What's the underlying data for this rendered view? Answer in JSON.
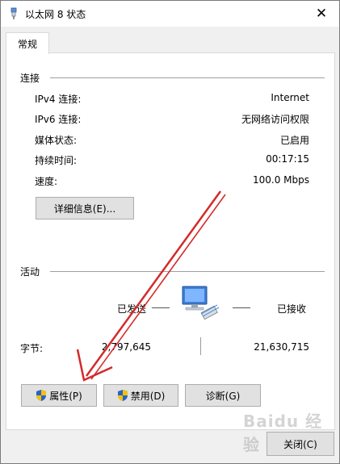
{
  "window": {
    "title": "以太网 8 状态",
    "tab": "常规"
  },
  "connection": {
    "heading": "连接",
    "rows": [
      {
        "label": "IPv4 连接:",
        "value": "Internet"
      },
      {
        "label": "IPv6 连接:",
        "value": "无网络访问权限"
      },
      {
        "label": "媒体状态:",
        "value": "已启用"
      },
      {
        "label": "持续时间:",
        "value": "00:17:15"
      },
      {
        "label": "速度:",
        "value": "100.0 Mbps"
      }
    ],
    "details_button": "详细信息(E)..."
  },
  "activity": {
    "heading": "活动",
    "sent_label": "已发送",
    "received_label": "已接收",
    "bytes_label": "字节:",
    "bytes_sent": "2,797,645",
    "bytes_received": "21,630,715"
  },
  "buttons": {
    "properties": "属性(P)",
    "disable": "禁用(D)",
    "diagnose": "诊断(G)",
    "close": "关闭(C)"
  },
  "watermark": "Baidu 经验",
  "colors": {
    "annotation_arrow": "#d42a2a",
    "button_face": "#e1e1e1",
    "shield_blue": "#2a62c9",
    "shield_yellow": "#f2c200"
  },
  "icons": {
    "title": "network-adapter-icon",
    "network": "network-computers-icon",
    "shield": "uac-shield-icon"
  }
}
